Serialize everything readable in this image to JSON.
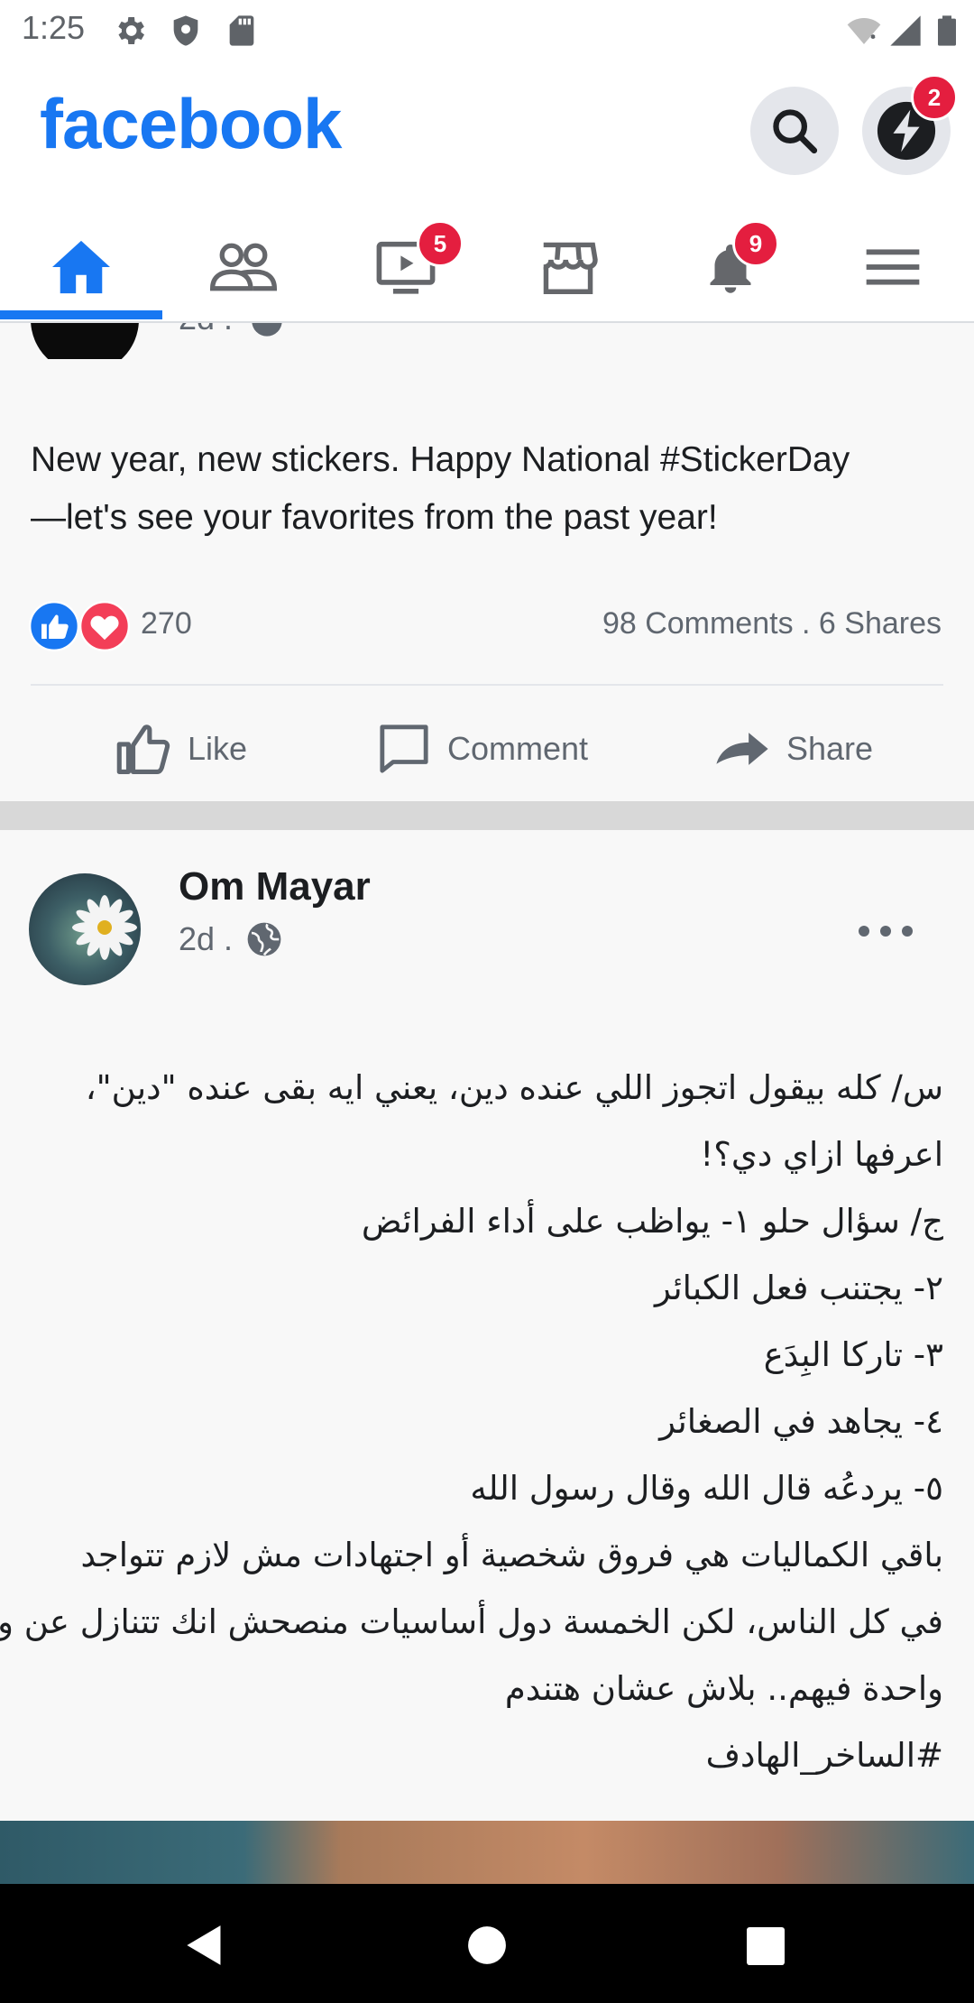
{
  "status_bar": {
    "time": "1:25"
  },
  "header": {
    "logo": "facebook",
    "messenger_badge": "2"
  },
  "tabs": [
    {
      "name": "home",
      "icon": "home-icon",
      "badge": ""
    },
    {
      "name": "friends",
      "icon": "friends-icon",
      "badge": ""
    },
    {
      "name": "watch",
      "icon": "video-icon",
      "badge": "5"
    },
    {
      "name": "marketplace",
      "icon": "store-icon",
      "badge": ""
    },
    {
      "name": "notifications",
      "icon": "bell-icon",
      "badge": "9"
    },
    {
      "name": "menu",
      "icon": "menu-icon",
      "badge": ""
    }
  ],
  "post1": {
    "time_partial": "2d .",
    "text_line1": "New year, new stickers. Happy National #StickerDay",
    "text_line2": "—let's see your favorites from the past year!",
    "reaction_count": "270",
    "comments_shares": "98 Comments . 6 Shares",
    "actions": {
      "like": "Like",
      "comment": "Comment",
      "share": "Share"
    }
  },
  "post2": {
    "author": "Om Mayar",
    "time": "2d .",
    "lines": [
      "س/ كله بيقول اتجوز اللي عنده دين، يعني ايه بقى عنده \"دين\"،",
      "اعرفها ازاي دي؟!",
      "ج/ سؤال حلو ١- يواظب على أداء الفرائض",
      "٢- يجتنب فعل الكبائر",
      "٣- تاركا البِدَع",
      "٤- يجاهد في الصغائر",
      "٥- يردعُه قال الله وقال رسول الله",
      "باقي الكماليات هي فروق شخصية أو اجتهادات مش لازم تتواجد",
      "في كل الناس، لكن الخمسة دول أساسيات منصحش انك تتنازل عن ولا",
      "واحدة فيهم.. بلاش عشان هتندم",
      "#الساخر_الهادف"
    ]
  },
  "colors": {
    "brand": "#1877f2",
    "badge": "#e41e3f",
    "secondary_text": "#606770"
  }
}
